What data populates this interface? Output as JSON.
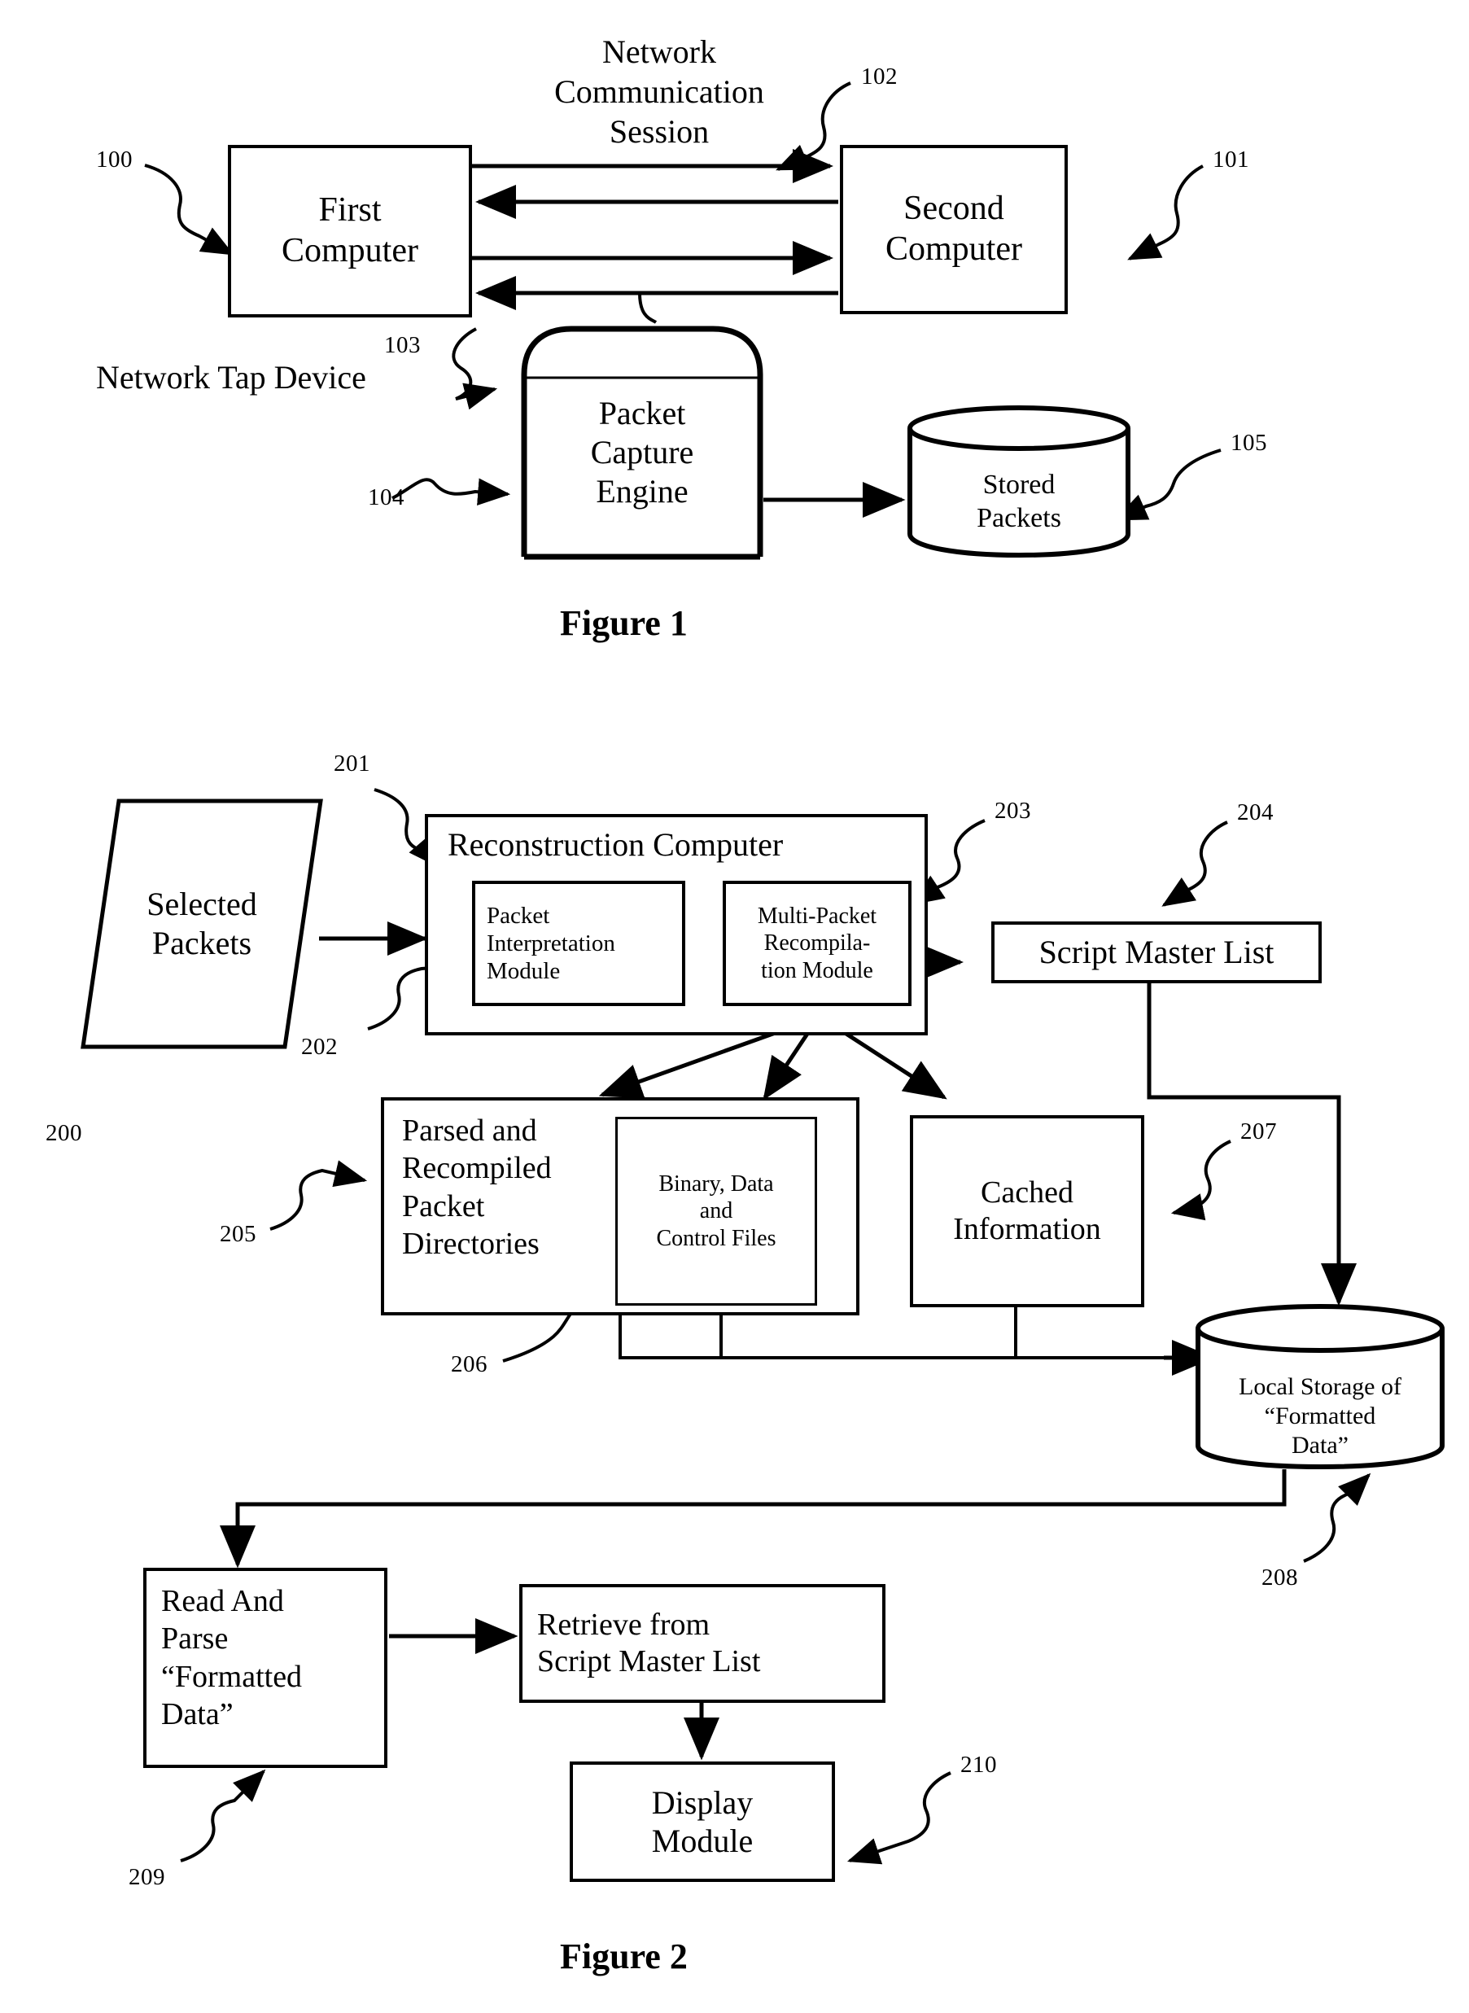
{
  "figure1": {
    "caption": "Figure 1",
    "nodes": {
      "first_computer": "First\nComputer",
      "second_computer": "Second\nComputer",
      "packet_capture_engine": "Packet\nCapture\nEngine",
      "stored_packets": "Stored\nPackets"
    },
    "labels": {
      "network_communication_session": "Network\nCommunication\nSession",
      "network_tap_device": "Network Tap Device"
    },
    "refs": {
      "first_computer": "100",
      "second_computer": "101",
      "session": "102",
      "tap_device": "103",
      "capture_engine": "104",
      "stored_packets": "105"
    }
  },
  "figure2": {
    "caption": "Figure 2",
    "nodes": {
      "selected_packets": "Selected\nPackets",
      "reconstruction_computer": "Reconstruction Computer",
      "packet_interpretation_module": "Packet\nInterpretation\nModule",
      "multi_packet_recompilation_module": "Multi-Packet\nRecompila-\ntion Module",
      "script_master_list": "Script Master List",
      "parsed_recompiled_packet_directories": "Parsed and\nRecompiled\nPacket\nDirectories",
      "binary_data_control_files": "Binary, Data\nand\nControl Files",
      "cached_information": "Cached\nInformation",
      "local_storage_formatted_data": "Local Storage of\n“Formatted\nData”",
      "read_and_parse_formatted_data": "Read And\nParse\n“Formatted\nData”",
      "retrieve_from_script_master_list": "Retrieve from\nScript Master List",
      "display_module": "Display\nModule"
    },
    "refs": {
      "selected_packets": "200",
      "reconstruction_computer": "201",
      "packet_interpretation_module": "202",
      "multi_packet_recompilation_module": "203",
      "script_master_list": "204",
      "parsed_recompiled_packet_directories": "205",
      "binary_data_control_files": "206",
      "cached_information": "207",
      "local_storage_formatted_data": "208",
      "read_and_parse_formatted_data": "209",
      "display_module": "210"
    }
  }
}
